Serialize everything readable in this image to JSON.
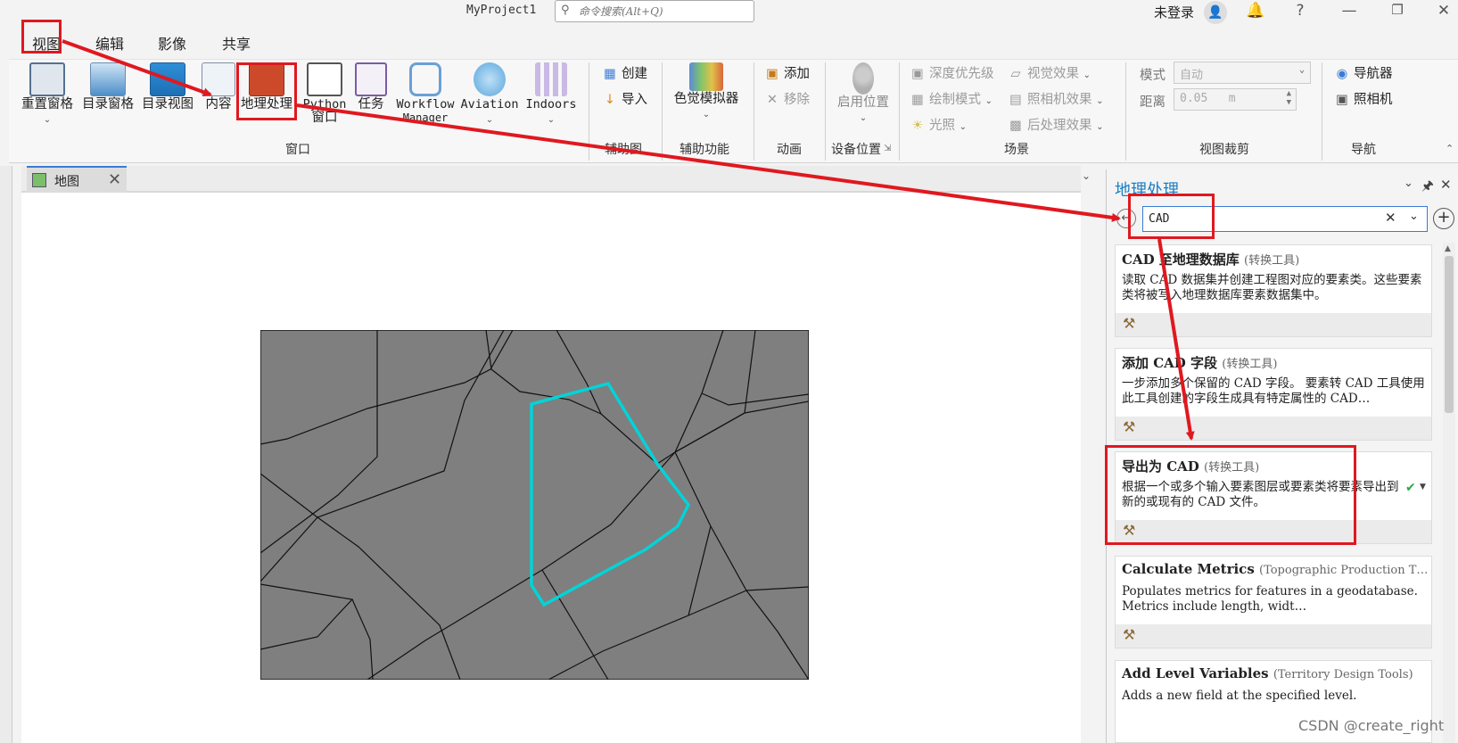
{
  "titlebar": {
    "project_name": "MyProject1",
    "search_placeholder": "命令搜索(Alt+Q)",
    "login_text": "未登录",
    "help_glyph": "?"
  },
  "ribbon_tabs": [
    "视图",
    "编辑",
    "影像",
    "共享"
  ],
  "ribbon": {
    "window_group": {
      "label": "窗口",
      "buttons": [
        "重置窗格",
        "目录窗格",
        "目录视图",
        "内容",
        "地理处理",
        "Python",
        "窗口",
        "任务",
        "Workflow",
        "Manager",
        "Aviation",
        "Indoors"
      ]
    },
    "cutfill_group": {
      "label": "辅助图",
      "create": "创建",
      "import": "导入"
    },
    "accessibility_group": {
      "label": "辅助功能",
      "color_simulator": "色觉模拟器"
    },
    "animation_group": {
      "label": "动画",
      "add": "添加",
      "remove": "移除"
    },
    "device_group": {
      "label": "设备位置",
      "enable_location": "启用位置"
    },
    "scene_group": {
      "label": "场景",
      "depth_priority": "深度优先级",
      "visual_effects": "视觉效果",
      "draw_mode": "绘制模式",
      "camera_effects": "照相机效果",
      "lighting": "光照",
      "post_effects": "后处理效果"
    },
    "clip_group": {
      "label": "视图裁剪",
      "mode_label": "模式",
      "mode_value": "自动",
      "distance_label": "距离",
      "distance_value": "0.05",
      "distance_unit": "m"
    },
    "nav_group": {
      "label": "导航",
      "navigator": "导航器",
      "camera": "照相机"
    }
  },
  "map_tab": {
    "label": "地图"
  },
  "geoprocessing": {
    "title": "地理处理",
    "search_value": "CAD",
    "results": [
      {
        "title": "CAD 至地理数据库",
        "toolbox": "(转换工具)",
        "description": "读取 CAD 数据集并创建工程图对应的要素类。这些要素类将被写入地理数据库要素数据集中。"
      },
      {
        "title": "添加 CAD 字段",
        "toolbox": "(转换工具)",
        "description": "一步添加多个保留的 CAD 字段。 要素转 CAD 工具使用此工具创建的字段生成具有特定属性的 CAD…"
      },
      {
        "title": "导出为 CAD",
        "toolbox": "(转换工具)",
        "description": "根据一个或多个输入要素图层或要素类将要素导出到新的或现有的 CAD 文件。"
      },
      {
        "title": "Calculate Metrics",
        "toolbox": "(Topographic Production T…",
        "description": "Populates metrics for features in a geodatabase. Metrics include length, widt…"
      },
      {
        "title": "Add Level Variables",
        "toolbox": "(Territory Design Tools)",
        "description": "Adds a new field at the specified level."
      }
    ]
  },
  "watermark": "CSDN @create_right",
  "colors": {
    "annotation_red": "#e0181f",
    "selection_cyan": "#00d4d8",
    "map_fill": "#7f7f7f",
    "accent_blue": "#1a7ec5"
  }
}
